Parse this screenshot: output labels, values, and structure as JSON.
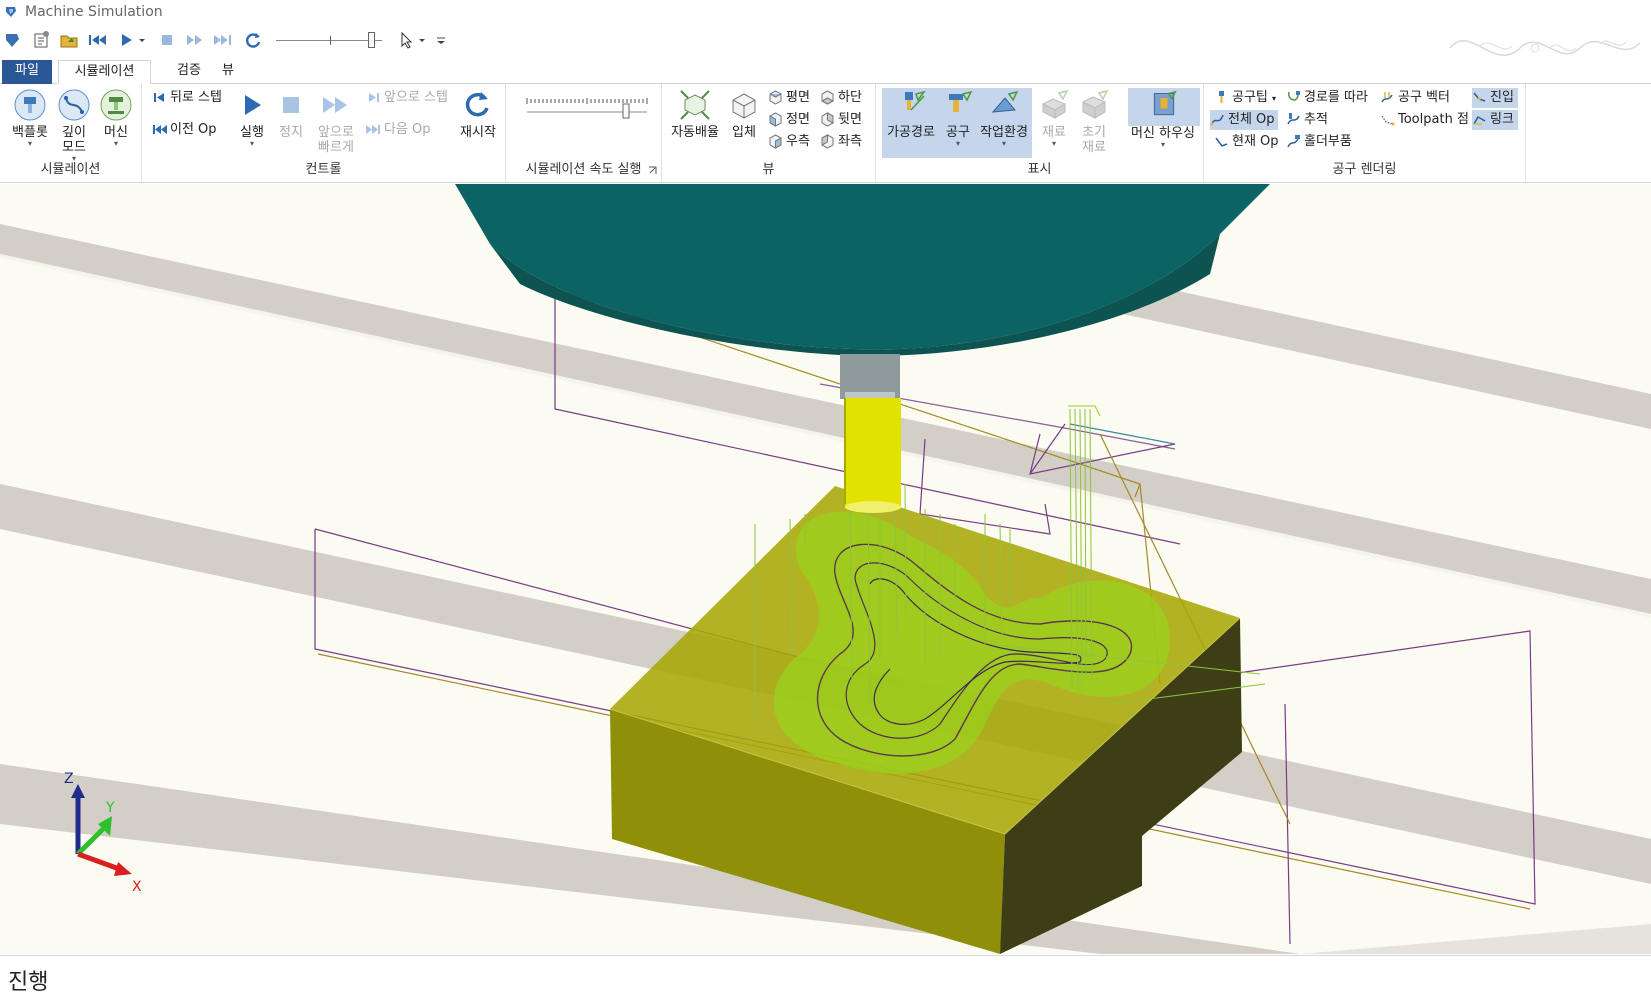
{
  "window": {
    "title": "Machine Simulation"
  },
  "tabs": {
    "file": "파일",
    "simulation": "시뮬레이션",
    "verify": "검증",
    "view": "뷰"
  },
  "ribbon": {
    "simulation_group": {
      "label": "시뮬레이션",
      "backplot": "백플롯",
      "depth_mode": [
        "깊이",
        "모드"
      ],
      "machine": "머신"
    },
    "control_group": {
      "label": "컨트롤",
      "step_back": "뒤로 스텝",
      "prev_op": "이전 Op",
      "run": "실행",
      "stop": "정지",
      "fast_forward": [
        "앞으로",
        "빠르게"
      ],
      "step_forward": "앞으로 스텝",
      "next_op": "다음 Op",
      "restart": "재시작"
    },
    "speed_group": {
      "label": "시뮬레이션 속도 실행"
    },
    "view_group": {
      "label": "뷰",
      "auto_fit": "자동배율",
      "isometric": "입체",
      "top": "평면",
      "front": "정면",
      "right": "우측",
      "bottom": "하단",
      "back": "뒷면",
      "left": "좌측"
    },
    "display_group": {
      "label": "표시",
      "toolpath": "가공경로",
      "tool": "공구",
      "workenv": "작업환경",
      "stock": "재료",
      "initial_stock": [
        "초기",
        "재료"
      ],
      "machine_housing": "머신 하우싱"
    },
    "tool_render_group": {
      "label": "공구 렌더링",
      "tool_tip": "공구팁",
      "follow_path": "경로를 따라",
      "tool_vector": "공구 벡터",
      "entry": "진입",
      "all_op": "전체 Op",
      "trace": "추적",
      "toolpath_point": "Toolpath 점",
      "link": "링크",
      "current_op": "현재 Op",
      "holder_parts": "홀더부품"
    }
  },
  "axes": {
    "x": "X",
    "y": "Y",
    "z": "Z"
  },
  "status": {
    "text": "진행"
  },
  "colors": {
    "file_tab": "#2b5797",
    "selected": "#c5d6ec",
    "spindle": "#0b6e6c",
    "tool": "#dede00",
    "stock": "#a6a600",
    "toolpath": "#8fc43a",
    "rapid": "#7a3a86"
  }
}
